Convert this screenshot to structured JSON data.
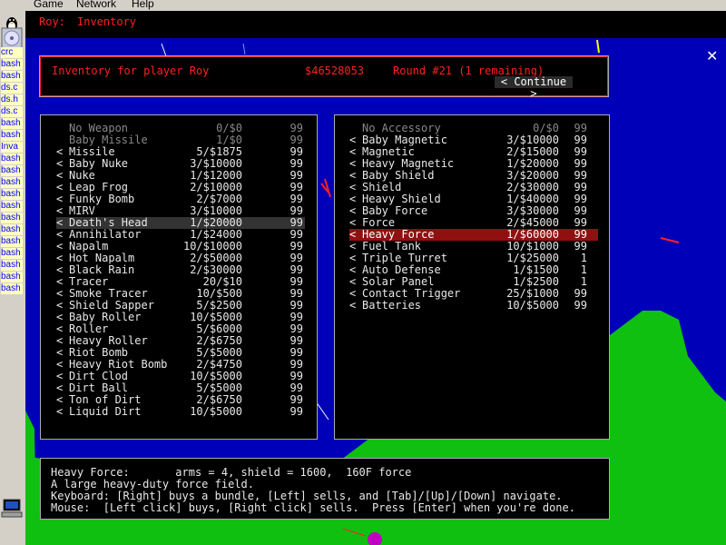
{
  "menu": [
    "Game",
    "Network",
    "Help"
  ],
  "taskbar": {
    "tasks": [
      "crc",
      "bash",
      "bash",
      "ds.c",
      "ds.h",
      "ds.c",
      "bash",
      "bash",
      "Inva",
      "bash",
      "bash",
      "bash",
      "bash",
      "bash",
      "bash",
      "bash",
      "bash",
      "bash",
      "bash",
      "bash",
      "bash"
    ]
  },
  "status": {
    "player": "Roy:",
    "mode": "Inventory"
  },
  "header": {
    "title": "Inventory for player Roy",
    "money": "$46528053",
    "round": "Round #21 (1  remaining)",
    "continue": "< Continue >"
  },
  "weapons": [
    {
      "name": "No Weapon",
      "qty": "0/$0",
      "count": "99",
      "dim": true
    },
    {
      "name": "Baby Missile",
      "qty": "1/$0",
      "count": "99",
      "dim": true
    },
    {
      "name": "Missile",
      "qty": "5/$1875",
      "count": "99"
    },
    {
      "name": "Baby Nuke",
      "qty": "3/$10000",
      "count": "99"
    },
    {
      "name": "Nuke",
      "qty": "1/$12000",
      "count": "99"
    },
    {
      "name": "Leap Frog",
      "qty": "2/$10000",
      "count": "99"
    },
    {
      "name": "Funky Bomb",
      "qty": "2/$7000",
      "count": "99"
    },
    {
      "name": "MIRV",
      "qty": "3/$10000",
      "count": "99"
    },
    {
      "name": "Death's Head",
      "qty": "1/$20000",
      "count": "99",
      "hl": "grey"
    },
    {
      "name": "Annihilator",
      "qty": "1/$24000",
      "count": "99"
    },
    {
      "name": "Napalm",
      "qty": "10/$10000",
      "count": "99"
    },
    {
      "name": "Hot Napalm",
      "qty": "2/$50000",
      "count": "99"
    },
    {
      "name": "Black Rain",
      "qty": "2/$30000",
      "count": "99"
    },
    {
      "name": "Tracer",
      "qty": "20/$10",
      "count": "99"
    },
    {
      "name": "Smoke Tracer",
      "qty": "10/$500",
      "count": "99"
    },
    {
      "name": "Shield Sapper",
      "qty": "5/$2500",
      "count": "99"
    },
    {
      "name": "Baby Roller",
      "qty": "10/$5000",
      "count": "99"
    },
    {
      "name": "Roller",
      "qty": "5/$6000",
      "count": "99"
    },
    {
      "name": "Heavy Roller",
      "qty": "2/$6750",
      "count": "99"
    },
    {
      "name": "Riot Bomb",
      "qty": "5/$5000",
      "count": "99"
    },
    {
      "name": "Heavy Riot Bomb",
      "qty": "2/$4750",
      "count": "99"
    },
    {
      "name": "Dirt Clod",
      "qty": "10/$5000",
      "count": "99"
    },
    {
      "name": "Dirt Ball",
      "qty": "5/$5000",
      "count": "99"
    },
    {
      "name": "Ton of Dirt",
      "qty": "2/$6750",
      "count": "99"
    },
    {
      "name": "Liquid Dirt",
      "qty": "10/$5000",
      "count": "99"
    }
  ],
  "accessories": [
    {
      "name": "No Accessory",
      "qty": "0/$0",
      "count": "99",
      "dim": true
    },
    {
      "name": "Baby Magnetic",
      "qty": "3/$10000",
      "count": "99"
    },
    {
      "name": "Magnetic",
      "qty": "2/$15000",
      "count": "99"
    },
    {
      "name": "Heavy Magnetic",
      "qty": "1/$20000",
      "count": "99"
    },
    {
      "name": "Baby Shield",
      "qty": "3/$20000",
      "count": "99"
    },
    {
      "name": "Shield",
      "qty": "2/$30000",
      "count": "99"
    },
    {
      "name": "Heavy Shield",
      "qty": "1/$40000",
      "count": "99"
    },
    {
      "name": "Baby Force",
      "qty": "3/$30000",
      "count": "99"
    },
    {
      "name": "Force",
      "qty": "2/$45000",
      "count": "99"
    },
    {
      "name": "Heavy Force",
      "qty": "1/$60000",
      "count": "99",
      "hl": "red"
    },
    {
      "name": "Fuel Tank",
      "qty": "10/$1000",
      "count": "99"
    },
    {
      "name": "Triple Turret",
      "qty": "1/$25000",
      "count": "1"
    },
    {
      "name": "Auto Defense",
      "qty": "1/$1500",
      "count": "1"
    },
    {
      "name": "Solar Panel",
      "qty": "1/$2500",
      "count": "1"
    },
    {
      "name": "Contact Trigger",
      "qty": "25/$1000",
      "count": "99"
    },
    {
      "name": "Batteries",
      "qty": "10/$5000",
      "count": "99"
    }
  ],
  "info": {
    "line1": "Heavy Force:       arms = 4, shield = 1600,  160F force",
    "line2": "A large heavy-duty force field.",
    "line3": "Keyboard: [Right] buys a bundle, [Left] sells, and [Tab]/[Up]/[Down] navigate.",
    "line4": "Mouse:  [Left click] buys, [Right click] sells.  Press [Enter] when you're done."
  },
  "colors": {
    "bg": "#0000b8",
    "accent": "#ff2020",
    "highlight": "#901010",
    "land": "#10c010"
  },
  "icons": {
    "tux": "tux-icon",
    "disc": "disc-icon",
    "close": "close-icon",
    "computer": "computer-icon"
  }
}
